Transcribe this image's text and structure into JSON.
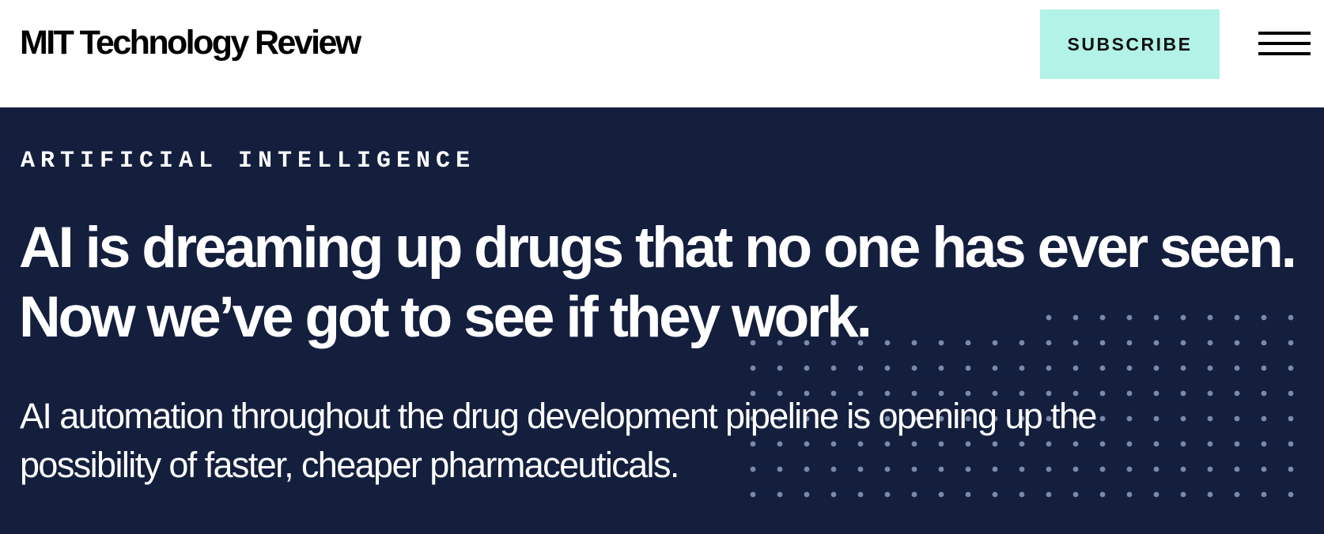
{
  "header": {
    "logo_text": "MIT Technology Review",
    "subscribe_label": "SUBSCRIBE",
    "menu_icon": "hamburger-menu-icon"
  },
  "article": {
    "category": "ARTIFICIAL INTELLIGENCE",
    "headline": "AI is dreaming up drugs that no one has ever seen. Now we’ve got to see if they work.",
    "dek": "AI automation throughout the drug development pipeline is opening up the possibility of faster, cheaper pharmaceuticals."
  },
  "colors": {
    "hero_background": "#141f3e",
    "hero_text": "#ffffff",
    "subscribe_background": "#b2f2e7",
    "subscribe_text": "#111111",
    "dot_pattern": "#7a8aac"
  }
}
